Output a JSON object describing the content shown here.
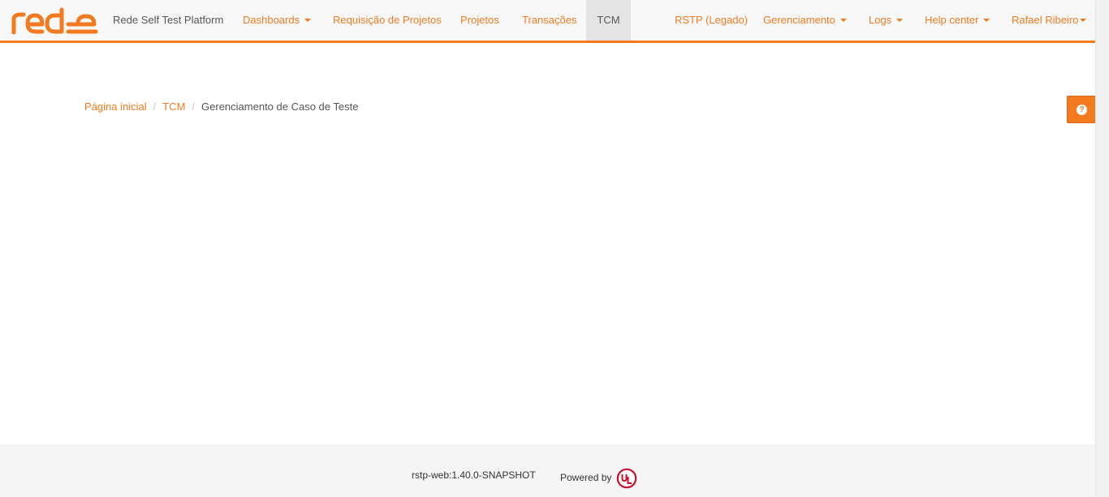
{
  "brand": {
    "logo_text": "rede",
    "app_name": "Rede Self Test Platform",
    "accent_color": "#f47a20"
  },
  "nav": {
    "dashboards": "Dashboards",
    "project_requests": "Requisição de Projetos",
    "projects": "Projetos",
    "transactions": "Transações",
    "tcm": "TCM",
    "legacy": "RSTP (Legado)",
    "management": "Gerenciamento",
    "logs": "Logs",
    "help_center": "Help center",
    "user": "Rafael Ribeiro",
    "active_item": "TCM"
  },
  "breadcrumb": {
    "home": "Página inicial",
    "tcm": "TCM",
    "current": "Gerenciamento de Caso de Teste",
    "separator": "/"
  },
  "help_button": {
    "icon": "question-circle-icon",
    "glyph": "?"
  },
  "footer": {
    "version": "rstp-web:1.40.0-SNAPSHOT",
    "powered_by": "Powered by",
    "ul_logo_text": "UL",
    "ul_color": "#c8102e"
  }
}
